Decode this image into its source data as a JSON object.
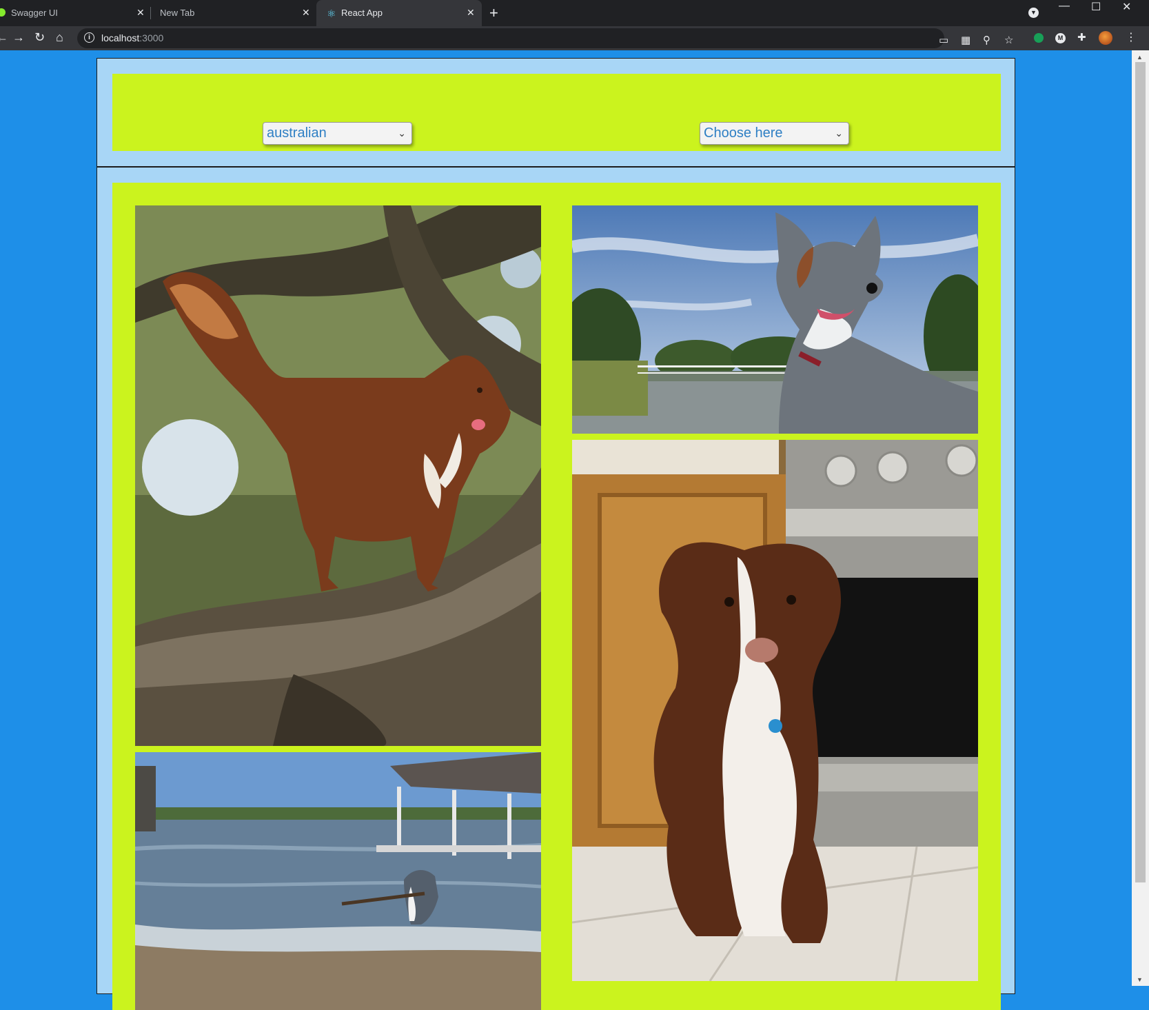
{
  "browser": {
    "tabs": [
      {
        "title": "Swagger UI"
      },
      {
        "title": "New Tab"
      },
      {
        "title": "React App"
      }
    ],
    "url_host": "localhost",
    "url_port": ":3000"
  },
  "filters": {
    "breed_select_value": "australian",
    "sub_breed_select_value": "Choose here"
  },
  "colors": {
    "page_background": "#1e8fe8",
    "panel": "#a8d6f6",
    "accent_lime": "#cbf31e",
    "select_text": "#2e7fc4"
  },
  "gallery": {
    "photos": [
      {
        "subject": "red merle dog standing on tree branch"
      },
      {
        "subject": "blue merle dog by lake and bridge"
      },
      {
        "subject": "dog fetching stick in lake near docks"
      },
      {
        "subject": "red tri dog sitting in kitchen by oven"
      }
    ]
  }
}
